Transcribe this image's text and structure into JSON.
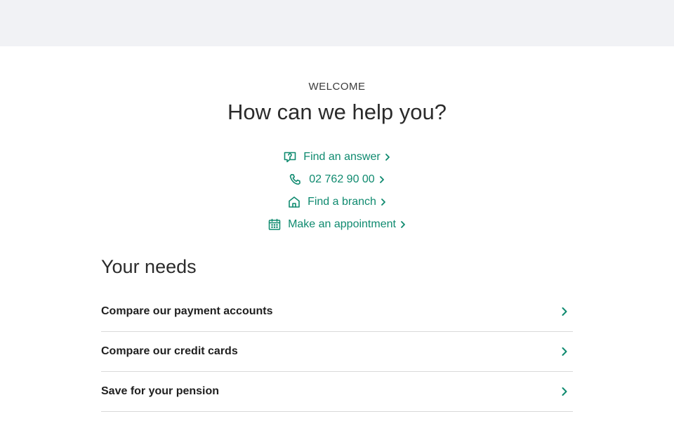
{
  "hero": {
    "eyebrow": "WELCOME",
    "headline": "How can we help you?"
  },
  "help_links": [
    {
      "label": "Find an answer",
      "icon": "question-bubble-icon"
    },
    {
      "label": "02 762 90 00",
      "icon": "phone-icon"
    },
    {
      "label": "Find a branch",
      "icon": "branch-house-icon"
    },
    {
      "label": "Make an appointment",
      "icon": "calendar-icon"
    }
  ],
  "needs": {
    "title": "Your needs",
    "items": [
      {
        "label": "Compare our payment accounts"
      },
      {
        "label": "Compare our credit cards"
      },
      {
        "label": "Save for your pension"
      }
    ]
  },
  "colors": {
    "accent": "#0f8a6f",
    "top_band": "#f1f2f5",
    "divider": "#d9d9d9"
  }
}
